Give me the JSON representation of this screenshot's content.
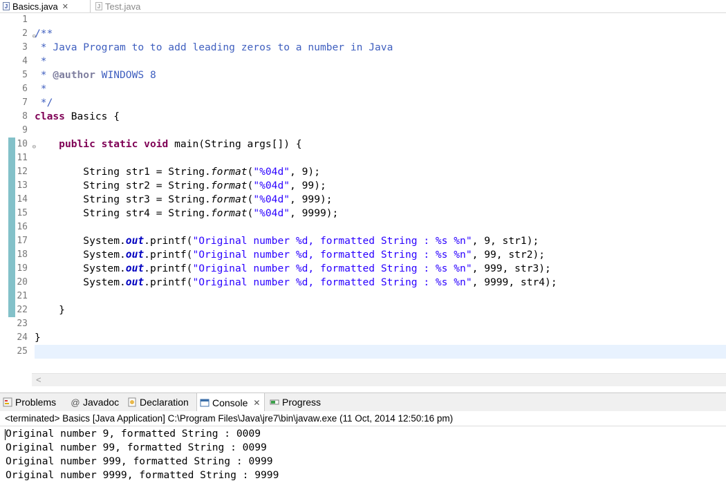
{
  "editor_tabs": [
    {
      "label": "Basics.java",
      "active": true,
      "close": "✕"
    },
    {
      "label": "Test.java",
      "active": false
    }
  ],
  "line_numbers": [
    "1",
    "2",
    "3",
    "4",
    "5",
    "6",
    "7",
    "8",
    "9",
    "10",
    "11",
    "12",
    "13",
    "14",
    "15",
    "16",
    "17",
    "18",
    "19",
    "20",
    "21",
    "22",
    "23",
    "24",
    "25"
  ],
  "code": {
    "l2": "/**",
    "l3": " * Java Program to to add leading zeros to a number in Java",
    "l4": " *",
    "l5_prefix": " * ",
    "l5_tag": "@author",
    "l5_text": " WINDOWS 8",
    "l6": " *",
    "l7": " */",
    "l8_kw": "class",
    "l8_text": " Basics {",
    "l10_indent": "    ",
    "l10_kw": "public static void",
    "l10_text": " main(String args[]) {",
    "str_decls": [
      {
        "pre": "        String str1 = String.",
        "method": "format",
        "open": "(",
        "fmt": "\"%04d\"",
        "rest": ", 9);"
      },
      {
        "pre": "        String str2 = String.",
        "method": "format",
        "open": "(",
        "fmt": "\"%04d\"",
        "rest": ", 99);"
      },
      {
        "pre": "        String str3 = String.",
        "method": "format",
        "open": "(",
        "fmt": "\"%04d\"",
        "rest": ", 999);"
      },
      {
        "pre": "        String str4 = String.",
        "method": "format",
        "open": "(",
        "fmt": "\"%04d\"",
        "rest": ", 9999);"
      }
    ],
    "print_lines": [
      {
        "pre": "        System.",
        "field": "out",
        "call": ".printf(",
        "fmt": "\"Original number %d, formatted String : %s %n\"",
        "rest": ", 9, str1);"
      },
      {
        "pre": "        System.",
        "field": "out",
        "call": ".printf(",
        "fmt": "\"Original number %d, formatted String : %s %n\"",
        "rest": ", 99, str2);"
      },
      {
        "pre": "        System.",
        "field": "out",
        "call": ".printf(",
        "fmt": "\"Original number %d, formatted String : %s %n\"",
        "rest": ", 999, str3);"
      },
      {
        "pre": "        System.",
        "field": "out",
        "call": ".printf(",
        "fmt": "\"Original number %d, formatted String : %s %n\"",
        "rest": ", 9999, str4);"
      }
    ],
    "l22": "    }",
    "l24": "}"
  },
  "scroll_left_arrow": "<",
  "view_tabs": [
    {
      "label": "Problems"
    },
    {
      "label": "Javadoc"
    },
    {
      "label": "Declaration"
    },
    {
      "label": "Console",
      "active": true,
      "close": "✕"
    },
    {
      "label": "Progress"
    }
  ],
  "console": {
    "terminated": "<terminated> Basics [Java Application] C:\\Program Files\\Java\\jre7\\bin\\javaw.exe (11 Oct, 2014 12:50:16 pm)",
    "output": [
      "Original number 9, formatted String : 0009",
      "Original number 99, formatted String : 0099",
      "Original number 999, formatted String : 0999",
      "Original number 9999, formatted String : 9999"
    ]
  },
  "colors": {
    "keyword": "#7f0055",
    "comment": "#3f5fbf",
    "string": "#2a00ff",
    "field": "#0000c0",
    "current_line": "#e8f2fe",
    "change_marker": "#83c1c9"
  }
}
